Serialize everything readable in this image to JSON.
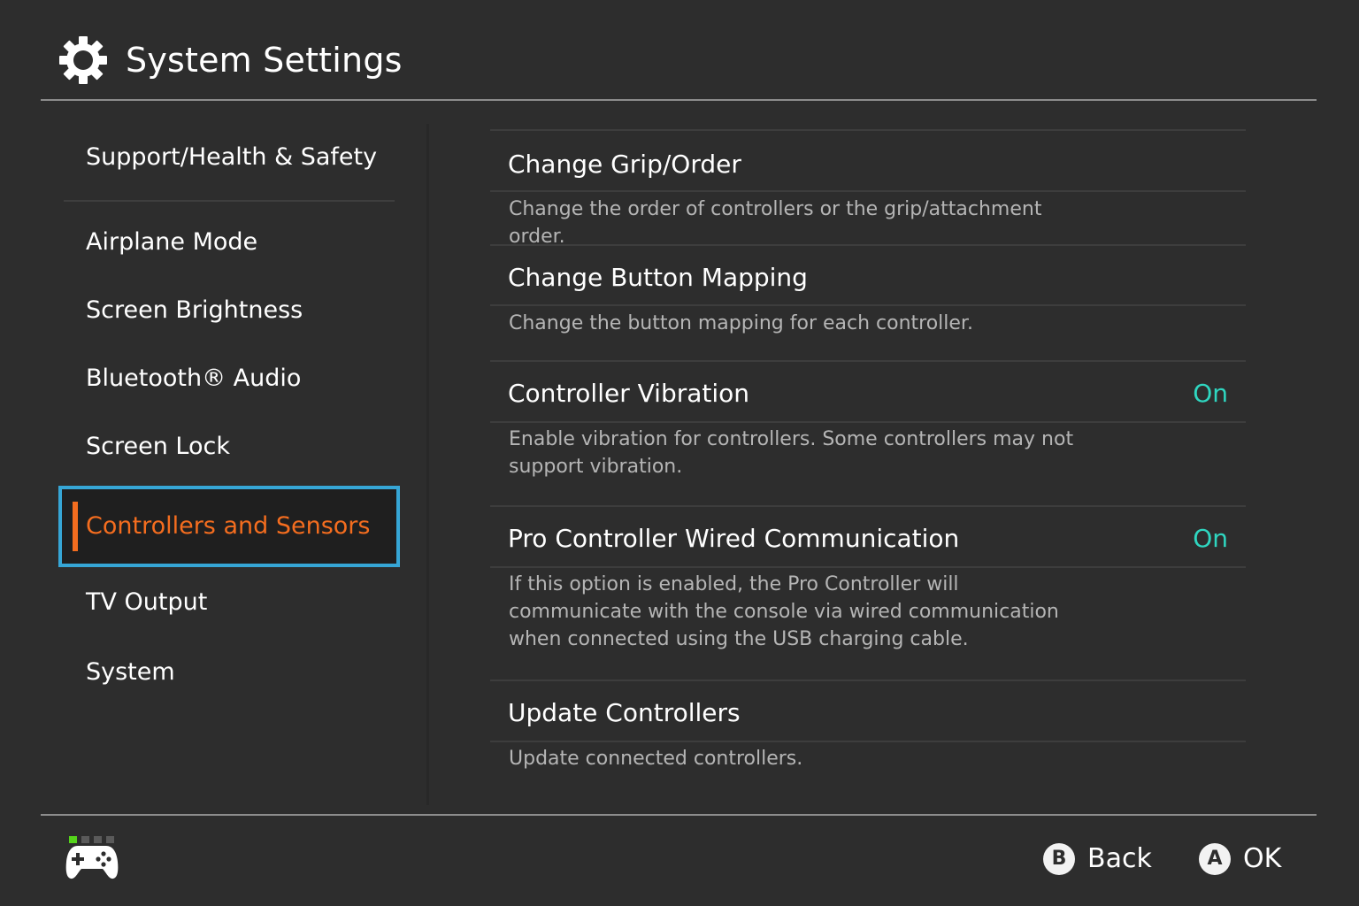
{
  "header": {
    "title": "System Settings",
    "icon": "gear-icon"
  },
  "sidebar": {
    "items": [
      {
        "label": "Support/Health & Safety"
      },
      {
        "label": "Airplane Mode"
      },
      {
        "label": "Screen Brightness"
      },
      {
        "label": "Bluetooth® Audio"
      },
      {
        "label": "Screen Lock"
      },
      {
        "label": "Controllers and Sensors",
        "selected": true
      },
      {
        "label": "TV Output"
      },
      {
        "label": "System"
      }
    ]
  },
  "content": {
    "rows": [
      {
        "title": "Change Grip/Order",
        "desc": "Change the order of controllers or the grip/attachment order.",
        "value": ""
      },
      {
        "title": "Change Button Mapping",
        "desc": "Change the button mapping for each controller.",
        "value": ""
      },
      {
        "title": "Controller Vibration",
        "desc": "Enable vibration for controllers. Some controllers may not support vibration.",
        "value": "On"
      },
      {
        "title": "Pro Controller Wired Communication",
        "desc": "If this option is enabled, the Pro Controller will communicate with the console via wired communication when connected using the USB charging cable.",
        "value": "On"
      },
      {
        "title": "Update Controllers",
        "desc": "Update connected controllers.",
        "value": ""
      }
    ]
  },
  "footer": {
    "player_count": 1,
    "back": {
      "key": "B",
      "label": "Back"
    },
    "ok": {
      "key": "A",
      "label": "OK"
    }
  },
  "colors": {
    "background": "#2d2d2d",
    "accent_selected": "#f46d1f",
    "selection_border": "#36a6d6",
    "value_on": "#2fd6c0",
    "player_active": "#55d41b"
  }
}
